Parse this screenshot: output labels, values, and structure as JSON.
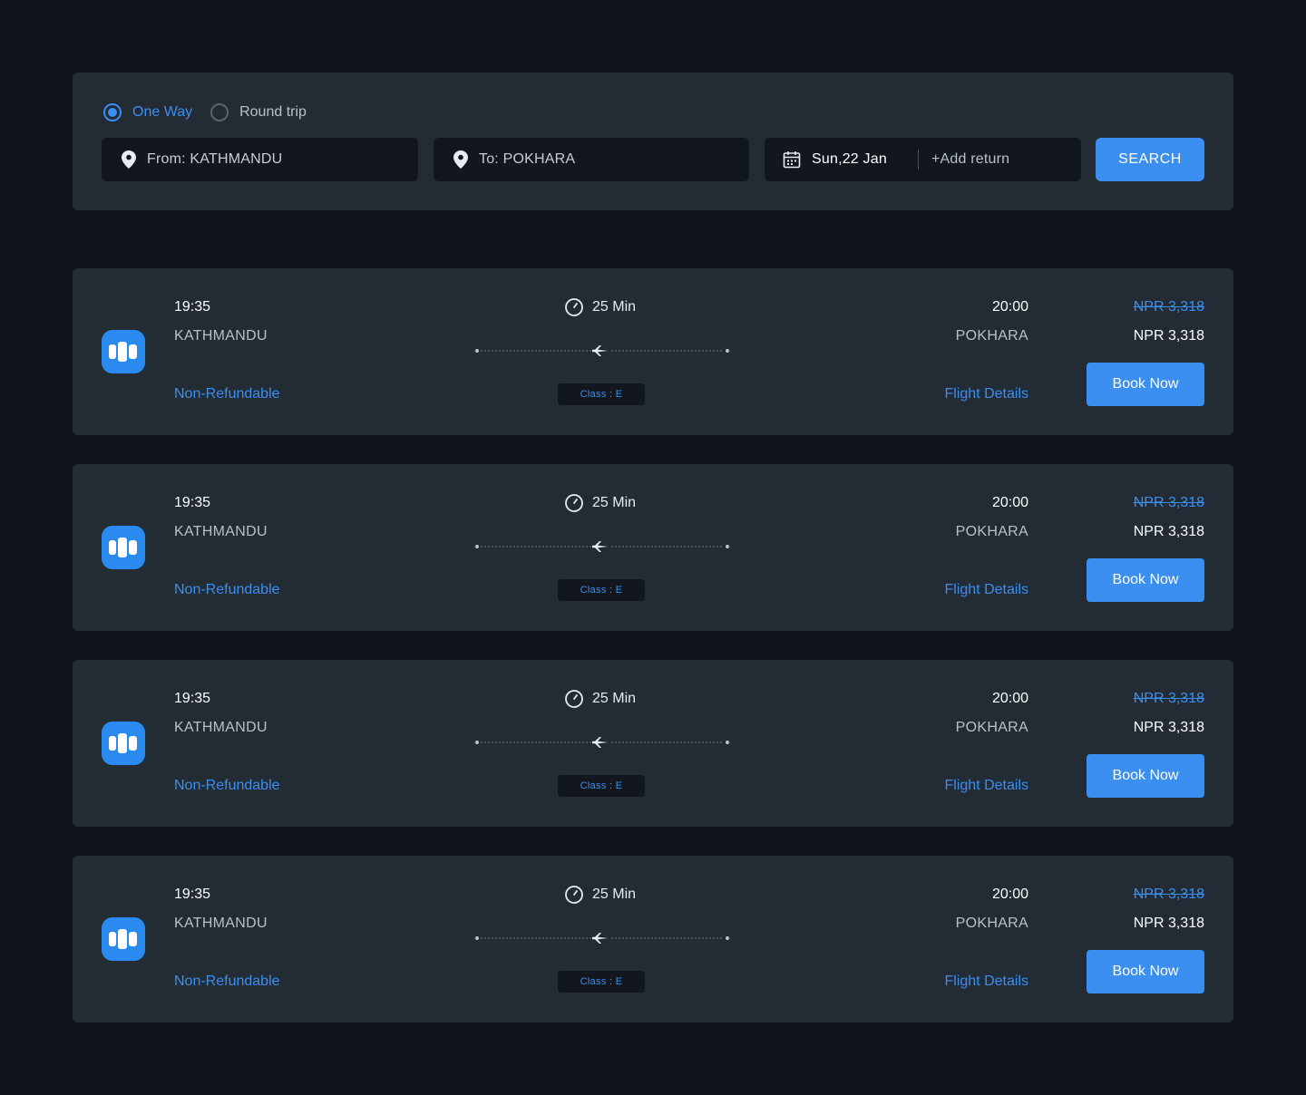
{
  "search": {
    "trip_types": [
      {
        "label": "One Way",
        "selected": true
      },
      {
        "label": "Round trip",
        "selected": false
      }
    ],
    "from_label": "From: KATHMANDU",
    "to_label": "To: POKHARA",
    "date_label": "Sun,22 Jan",
    "add_return_label": "+Add return",
    "search_button": "SEARCH"
  },
  "icons": {
    "location": "location-pin-icon",
    "calendar": "calendar-icon",
    "clock": "clock-icon",
    "plane": "plane-icon",
    "airline_logo": "airline-logo-icon"
  },
  "colors": {
    "accent": "#3b8ff0",
    "background": "#0f141c",
    "panel": "#232b35",
    "field": "#12171f"
  },
  "flights": [
    {
      "dep_time": "19:35",
      "dep_city": "KATHMANDU",
      "refund": "Non-Refundable",
      "duration": "25 Min",
      "class": "Class : E",
      "arr_time": "20:00",
      "arr_city": "POKHARA",
      "details": "Flight Details",
      "old_price": "NPR 3,318",
      "price": "NPR 3,318",
      "book": "Book Now"
    },
    {
      "dep_time": "19:35",
      "dep_city": "KATHMANDU",
      "refund": "Non-Refundable",
      "duration": "25 Min",
      "class": "Class : E",
      "arr_time": "20:00",
      "arr_city": "POKHARA",
      "details": "Flight Details",
      "old_price": "NPR 3,318",
      "price": "NPR 3,318",
      "book": "Book Now"
    },
    {
      "dep_time": "19:35",
      "dep_city": "KATHMANDU",
      "refund": "Non-Refundable",
      "duration": "25 Min",
      "class": "Class : E",
      "arr_time": "20:00",
      "arr_city": "POKHARA",
      "details": "Flight Details",
      "old_price": "NPR 3,318",
      "price": "NPR 3,318",
      "book": "Book Now"
    },
    {
      "dep_time": "19:35",
      "dep_city": "KATHMANDU",
      "refund": "Non-Refundable",
      "duration": "25 Min",
      "class": "Class : E",
      "arr_time": "20:00",
      "arr_city": "POKHARA",
      "details": "Flight Details",
      "old_price": "NPR 3,318",
      "price": "NPR 3,318",
      "book": "Book Now"
    }
  ]
}
